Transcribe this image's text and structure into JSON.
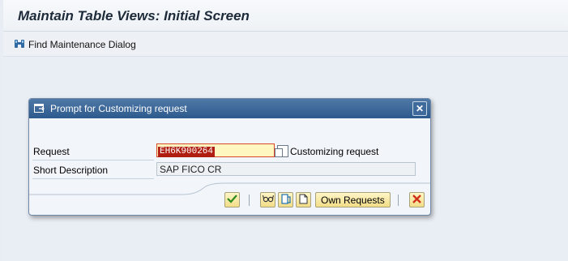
{
  "window": {
    "title": "Maintain Table Views: Initial Screen"
  },
  "toolbar": {
    "find_maintenance_dialog": "Find Maintenance Dialog"
  },
  "dialog": {
    "title": "Prompt for Customizing request",
    "request_label": "Request",
    "request_value": "EH6K900264",
    "request_type": "Customizing request",
    "short_description_label": "Short Description",
    "short_description_value": "SAP FICO CR",
    "own_requests_label": "Own Requests"
  },
  "colors": {
    "title_bar": "#2d5a8e",
    "request_highlight": "#b01e12",
    "button_face": "#f2dd86"
  }
}
